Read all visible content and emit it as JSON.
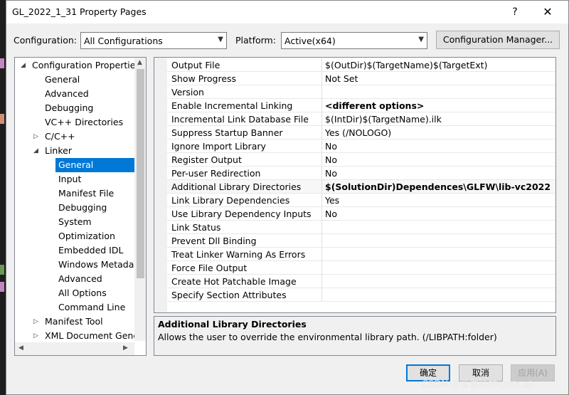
{
  "window": {
    "title": "GL_2022_1_31 Property Pages",
    "help": "?",
    "close": "✕"
  },
  "toolbar": {
    "configuration_label": "Configuration:",
    "configuration_value": "All Configurations",
    "platform_label": "Platform:",
    "platform_value": "Active(x64)",
    "config_manager": "Configuration Manager..."
  },
  "tree": [
    {
      "label": "Configuration Properties",
      "expander": "◢"
    },
    {
      "label": "General"
    },
    {
      "label": "Advanced"
    },
    {
      "label": "Debugging"
    },
    {
      "label": "VC++ Directories"
    },
    {
      "label": "C/C++",
      "expander": "▷"
    },
    {
      "label": "Linker",
      "expander": "◢"
    },
    {
      "label": "General",
      "selected": true
    },
    {
      "label": "Input"
    },
    {
      "label": "Manifest File"
    },
    {
      "label": "Debugging"
    },
    {
      "label": "System"
    },
    {
      "label": "Optimization"
    },
    {
      "label": "Embedded IDL"
    },
    {
      "label": "Windows Metada"
    },
    {
      "label": "Advanced"
    },
    {
      "label": "All Options"
    },
    {
      "label": "Command Line"
    },
    {
      "label": "Manifest Tool",
      "expander": "▷"
    },
    {
      "label": "XML Document Gene",
      "expander": "▷"
    }
  ],
  "properties": [
    {
      "name": "Output File",
      "value": "$(OutDir)$(TargetName)$(TargetExt)"
    },
    {
      "name": "Show Progress",
      "value": "Not Set"
    },
    {
      "name": "Version",
      "value": ""
    },
    {
      "name": "Enable Incremental Linking",
      "value": "<different options>",
      "bold": true
    },
    {
      "name": "Incremental Link Database File",
      "value": "$(IntDir)$(TargetName).ilk"
    },
    {
      "name": "Suppress Startup Banner",
      "value": "Yes (/NOLOGO)"
    },
    {
      "name": "Ignore Import Library",
      "value": "No"
    },
    {
      "name": "Register Output",
      "value": "No"
    },
    {
      "name": "Per-user Redirection",
      "value": "No"
    },
    {
      "name": "Additional Library Directories",
      "value": "$(SolutionDir)Dependences\\GLFW\\lib-vc2022",
      "bold": true,
      "highlight": true
    },
    {
      "name": "Link Library Dependencies",
      "value": "Yes"
    },
    {
      "name": "Use Library Dependency Inputs",
      "value": "No"
    },
    {
      "name": "Link Status",
      "value": ""
    },
    {
      "name": "Prevent Dll Binding",
      "value": ""
    },
    {
      "name": "Treat Linker Warning As Errors",
      "value": ""
    },
    {
      "name": "Force File Output",
      "value": ""
    },
    {
      "name": "Create Hot Patchable Image",
      "value": ""
    },
    {
      "name": "Specify Section Attributes",
      "value": ""
    }
  ],
  "description": {
    "title": "Additional Library Directories",
    "text": "Allows the user to override the environmental library path. (/LIBPATH:folder)"
  },
  "buttons": {
    "ok": "确定",
    "cancel": "取消",
    "apply": "应用(A)"
  },
  "watermark": "CSDN @爱冒险的qm(s,a)",
  "colors": {
    "selection": "#0078d7",
    "dialog_bg": "#f0f0f0"
  }
}
